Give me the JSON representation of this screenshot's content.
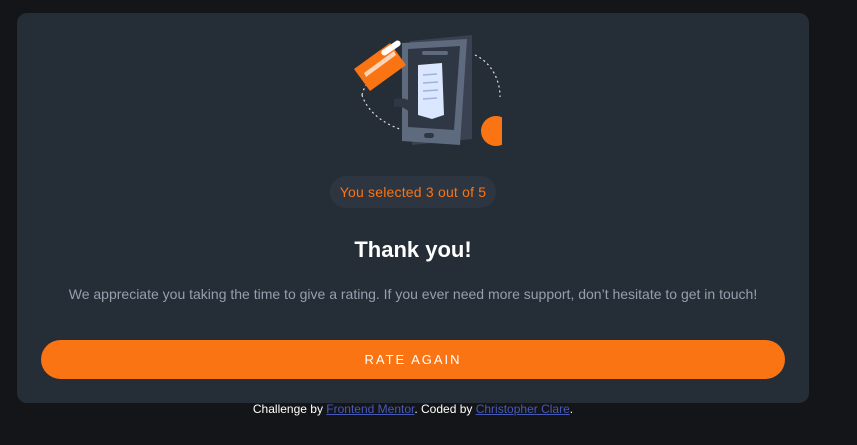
{
  "card": {
    "illustration_icon": "phone-payment-illustration",
    "badge": {
      "prefix": "You selected",
      "selected": "3",
      "middle": "out of",
      "total": "5"
    },
    "title": "Thank you!",
    "message": "We appreciate you taking the time to give a rating. If you ever need more support, don’t hesitate to get in touch!",
    "button_label": "RATE AGAIN"
  },
  "footer": {
    "challenge_prefix": "Challenge by ",
    "challenge_link": "Frontend Mentor",
    "coded_prefix": ". Coded by ",
    "coded_link": "Christopher Clare",
    "suffix": "."
  },
  "colors": {
    "page_background": "#131518",
    "card_background": "#252d37",
    "accent": "#fb7413",
    "muted_text": "#969fad",
    "link": "#4759b8"
  }
}
